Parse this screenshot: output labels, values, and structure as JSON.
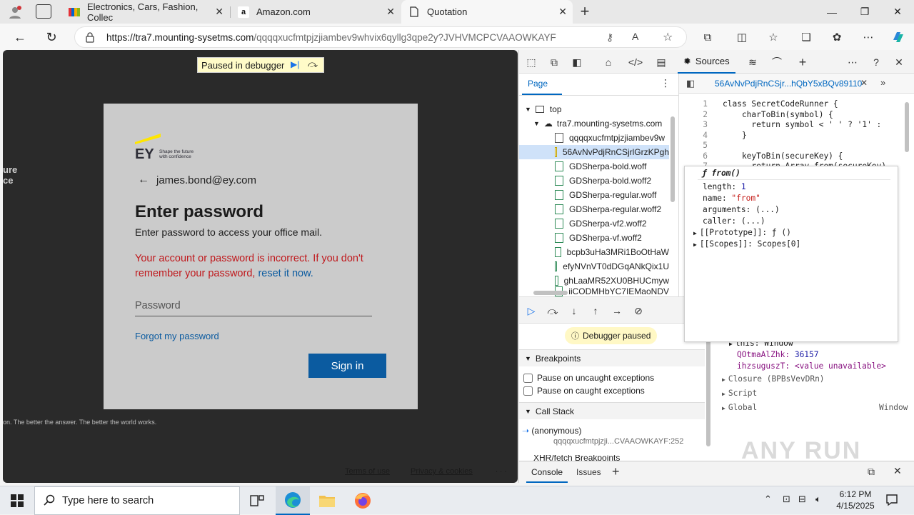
{
  "browser": {
    "tabs": [
      {
        "title": "Electronics, Cars, Fashion, Collec",
        "icon": "ebay-icon"
      },
      {
        "title": "Amazon.com",
        "icon": "amazon-icon"
      },
      {
        "title": "Quotation",
        "icon": "page-icon"
      }
    ],
    "url_host": "https://tra7.mounting-sysetms.com",
    "url_path": "/qqqqxucfmtpjzjiambev9whvix6qyllg3qpe2y?JVHVMCPCVAAOWKAYF"
  },
  "page": {
    "paused_banner": "Paused in debugger",
    "left_fragment_1": "ure",
    "left_fragment_2": "ce",
    "footer_tagline": "on. The better the answer. The better the world works.",
    "logo_text": "EY",
    "logo_tagline_1": "Shape the future",
    "logo_tagline_2": "with confidence",
    "email": "james.bond@ey.com",
    "title": "Enter password",
    "subtitle": "Enter password to access your office mail.",
    "error_text": "Your account or password is incorrect. If you don't remember your password, ",
    "error_link": "reset it now.",
    "password_placeholder": "Password",
    "forgot_link": "Forgot my password",
    "signin_button": "Sign in",
    "terms": "Terms of use",
    "privacy": "Privacy & cookies",
    "more": ". . ."
  },
  "devtools": {
    "sources_tab": "Sources",
    "page_tab": "Page",
    "tree": {
      "top": "top",
      "domain": "tra7.mounting-sysetms.com",
      "files": [
        "qqqqxucfmtpjzjiambev9w",
        "56AvNvPdjRnCSjrlGrzKPgh",
        "GDSherpa-bold.woff",
        "GDSherpa-bold.woff2",
        "GDSherpa-regular.woff",
        "GDSherpa-regular.woff2",
        "GDSherpa-vf2.woff2",
        "GDSherpa-vf.woff2",
        "bcpb3uHa3MRi1BoOtHaW",
        "efyNVnVT0dDGqANkQix1U",
        "ghLaaMR52XU0BHUCmyw",
        "iiCODMHbYC7IEMaoNDV"
      ]
    },
    "open_file": "56AvNvPdjRnCSjr...hQbY5xBQv89110",
    "code": [
      {
        "n": "1",
        "text": "class SecretCodeRunner {"
      },
      {
        "n": "2",
        "text": "    charToBin(symbol) {"
      },
      {
        "n": "3",
        "text": "      return symbol < ' ' ? '1' :"
      },
      {
        "n": "4",
        "text": "    }"
      },
      {
        "n": "5",
        "text": ""
      },
      {
        "n": "6",
        "text": "    keyToBin(secureKey) {"
      },
      {
        "n": "7",
        "text": "      return Array.from(secureKey)"
      }
    ],
    "popover": {
      "header": "ƒ from()",
      "rows": [
        {
          "k": "length:",
          "v": " 1",
          "vc": "#1a1aa6"
        },
        {
          "k": "name:",
          "v": " \"from\"",
          "vc": "#c41a16"
        },
        {
          "k": "arguments:",
          "v": " (...)",
          "vc": "#1b1b1b"
        },
        {
          "k": "caller:",
          "v": " (...)",
          "vc": "#1b1b1b"
        }
      ],
      "proto": "[[Prototype]]: ƒ ()",
      "scopes": "[[Scopes]]: Scopes[0]"
    },
    "debugger_paused": "Debugger paused",
    "breakpoints": "Breakpoints",
    "pause_uncaught": "Pause on uncaught exceptions",
    "pause_caught": "Pause on caught exceptions",
    "call_stack": "Call Stack",
    "frame_name": "(anonymous)",
    "frame_loc": "qqqqxucfmtpjzji...CVAAOWKAYF:252",
    "xhr_cut": "XHR/fetch Breakpoints",
    "scope": {
      "this": "this: Window",
      "var1_name": "QOtmaAlZhk:",
      "var1_val": " 36157",
      "var2_name": "ihzsuguszT:",
      "var2_val": " <value unavailable>",
      "closure": "Closure (BPBsVevDRn)",
      "script": "Script",
      "global": "Global",
      "global_val": "Window"
    },
    "drawer": {
      "console": "Console",
      "issues": "Issues"
    }
  },
  "taskbar": {
    "search_placeholder": "Type here to search",
    "time": "6:12 PM",
    "date": "4/15/2025"
  },
  "watermark": "ANY RUN"
}
